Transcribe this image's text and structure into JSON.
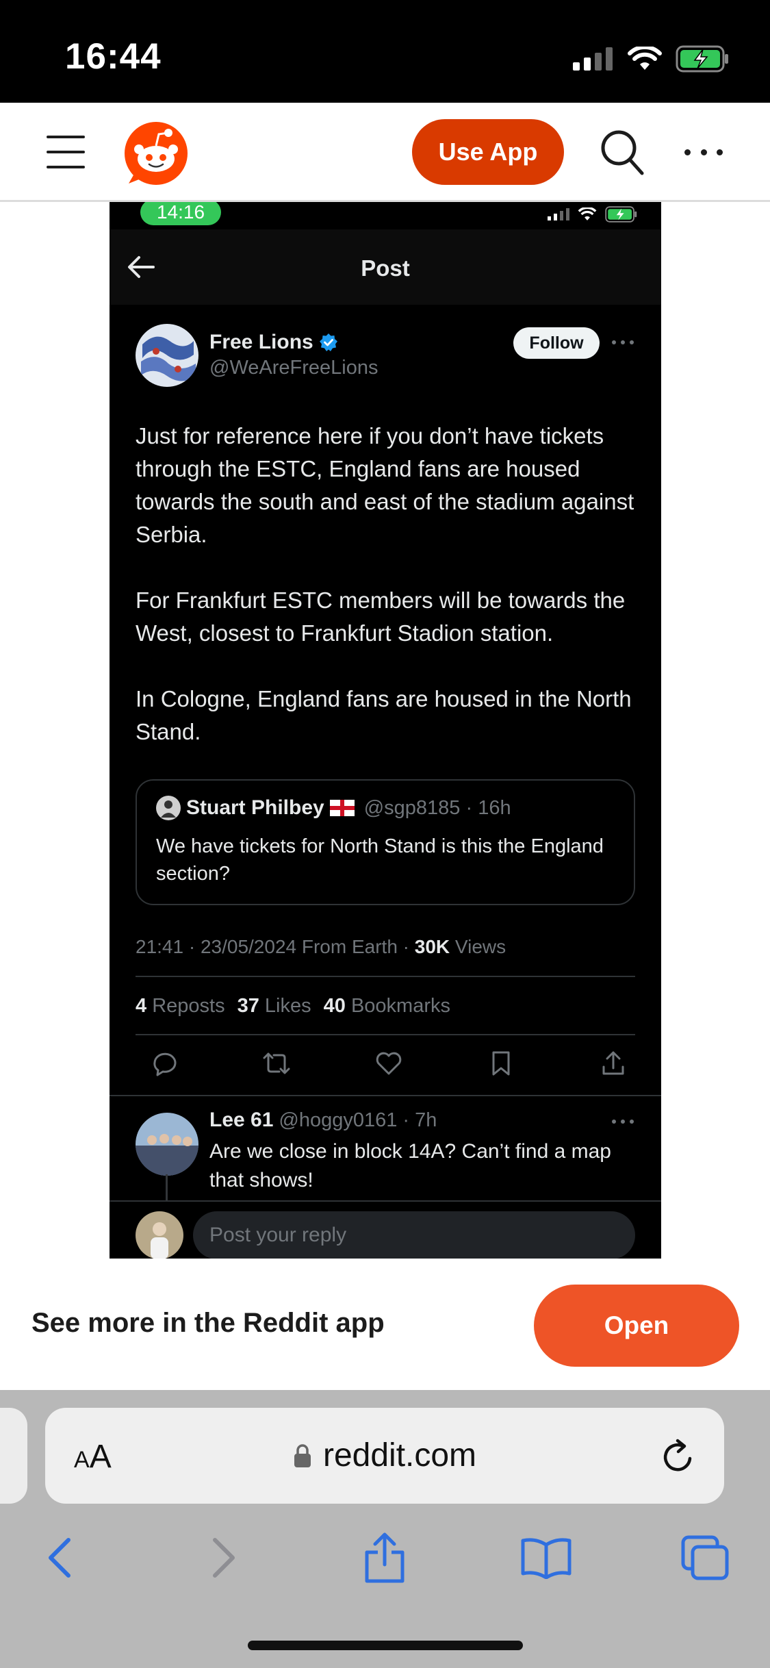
{
  "status_bar": {
    "time": "16:44"
  },
  "reddit_header": {
    "use_app_label": "Use App"
  },
  "embedded_post": {
    "status_time": "14:16",
    "nav_title": "Post",
    "author": {
      "name": "Free Lions",
      "handle": "@WeAreFreeLions",
      "verified": true
    },
    "follow_label": "Follow",
    "body_paragraphs": [
      "Just for reference here if you don’t have tickets through the ESTC, England fans are housed towards the south and east of the stadium against Serbia.",
      "For Frankfurt ESTC members will be towards the West, closest to Frankfurt Stadion station.",
      "In Cologne, England fans are housed in the North Stand."
    ],
    "quote": {
      "name": "Stuart Philbey",
      "handle": "@sgp8185 · 16h",
      "text": "We have tickets for North Stand is this the England section?"
    },
    "meta": {
      "timestamp": "21:41 · 23/05/2024 From Earth · ",
      "views_count": "30K",
      "views_label": " Views"
    },
    "stats": {
      "reposts_count": "4",
      "reposts_label": "Reposts",
      "likes_count": "37",
      "likes_label": "Likes",
      "bookmarks_count": "40",
      "bookmarks_label": "Bookmarks"
    },
    "reply": {
      "name": "Lee 61",
      "handle": "@hoggy0161 · 7h",
      "text": "Are we close in block 14A? Can’t find a map that shows!"
    },
    "reply_placeholder": "Post your reply"
  },
  "app_banner": {
    "text": "See more in the Reddit app",
    "open_label": "Open"
  },
  "safari": {
    "aa_big": "A",
    "aa_small": "A",
    "url": "reddit.com"
  },
  "colors": {
    "reddit_orange": "#d93a00",
    "open_orange": "#ee5427",
    "safari_blue": "#2f6fdf",
    "twitter_blue": "#1d9bf0"
  }
}
